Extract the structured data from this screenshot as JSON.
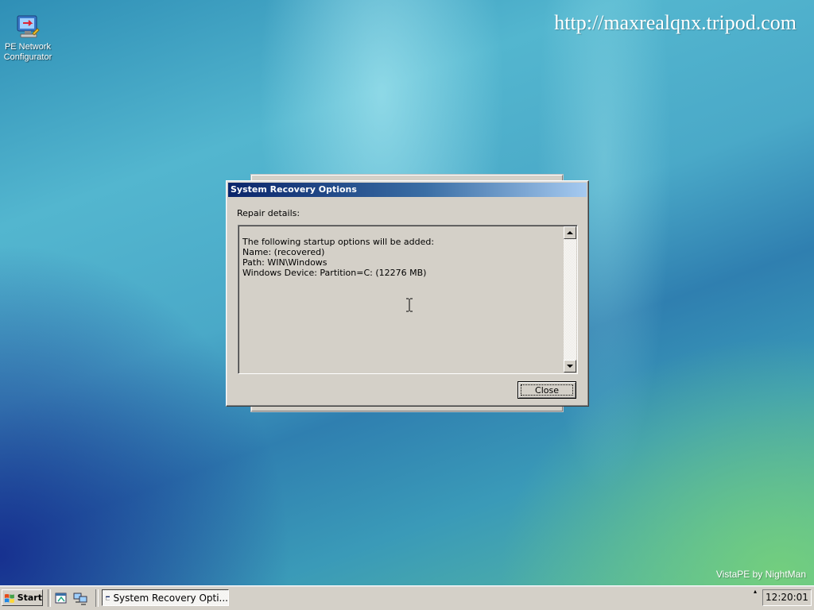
{
  "desktop": {
    "icon_label_line1": "PE Network",
    "icon_label_line2": "Configurator",
    "url_text": "http://maxrealqnx.tripod.com",
    "brand_text": "VistaPE by NightMan"
  },
  "dialog": {
    "title": "System Recovery Options",
    "label": "Repair details:",
    "details": [
      "The following startup options will be added:",
      "Name:  (recovered)",
      "Path: WIN\\Windows",
      "Windows Device: Partition=C: (12276 MB)"
    ],
    "close_label": "Close"
  },
  "taskbar": {
    "start_label": "Start",
    "task_label": "System Recovery Opti...",
    "clock": "12:20:01"
  },
  "colors": {
    "titlebar_start": "#0a246a",
    "titlebar_end": "#a6caf0",
    "window_face": "#d4d0c8"
  }
}
